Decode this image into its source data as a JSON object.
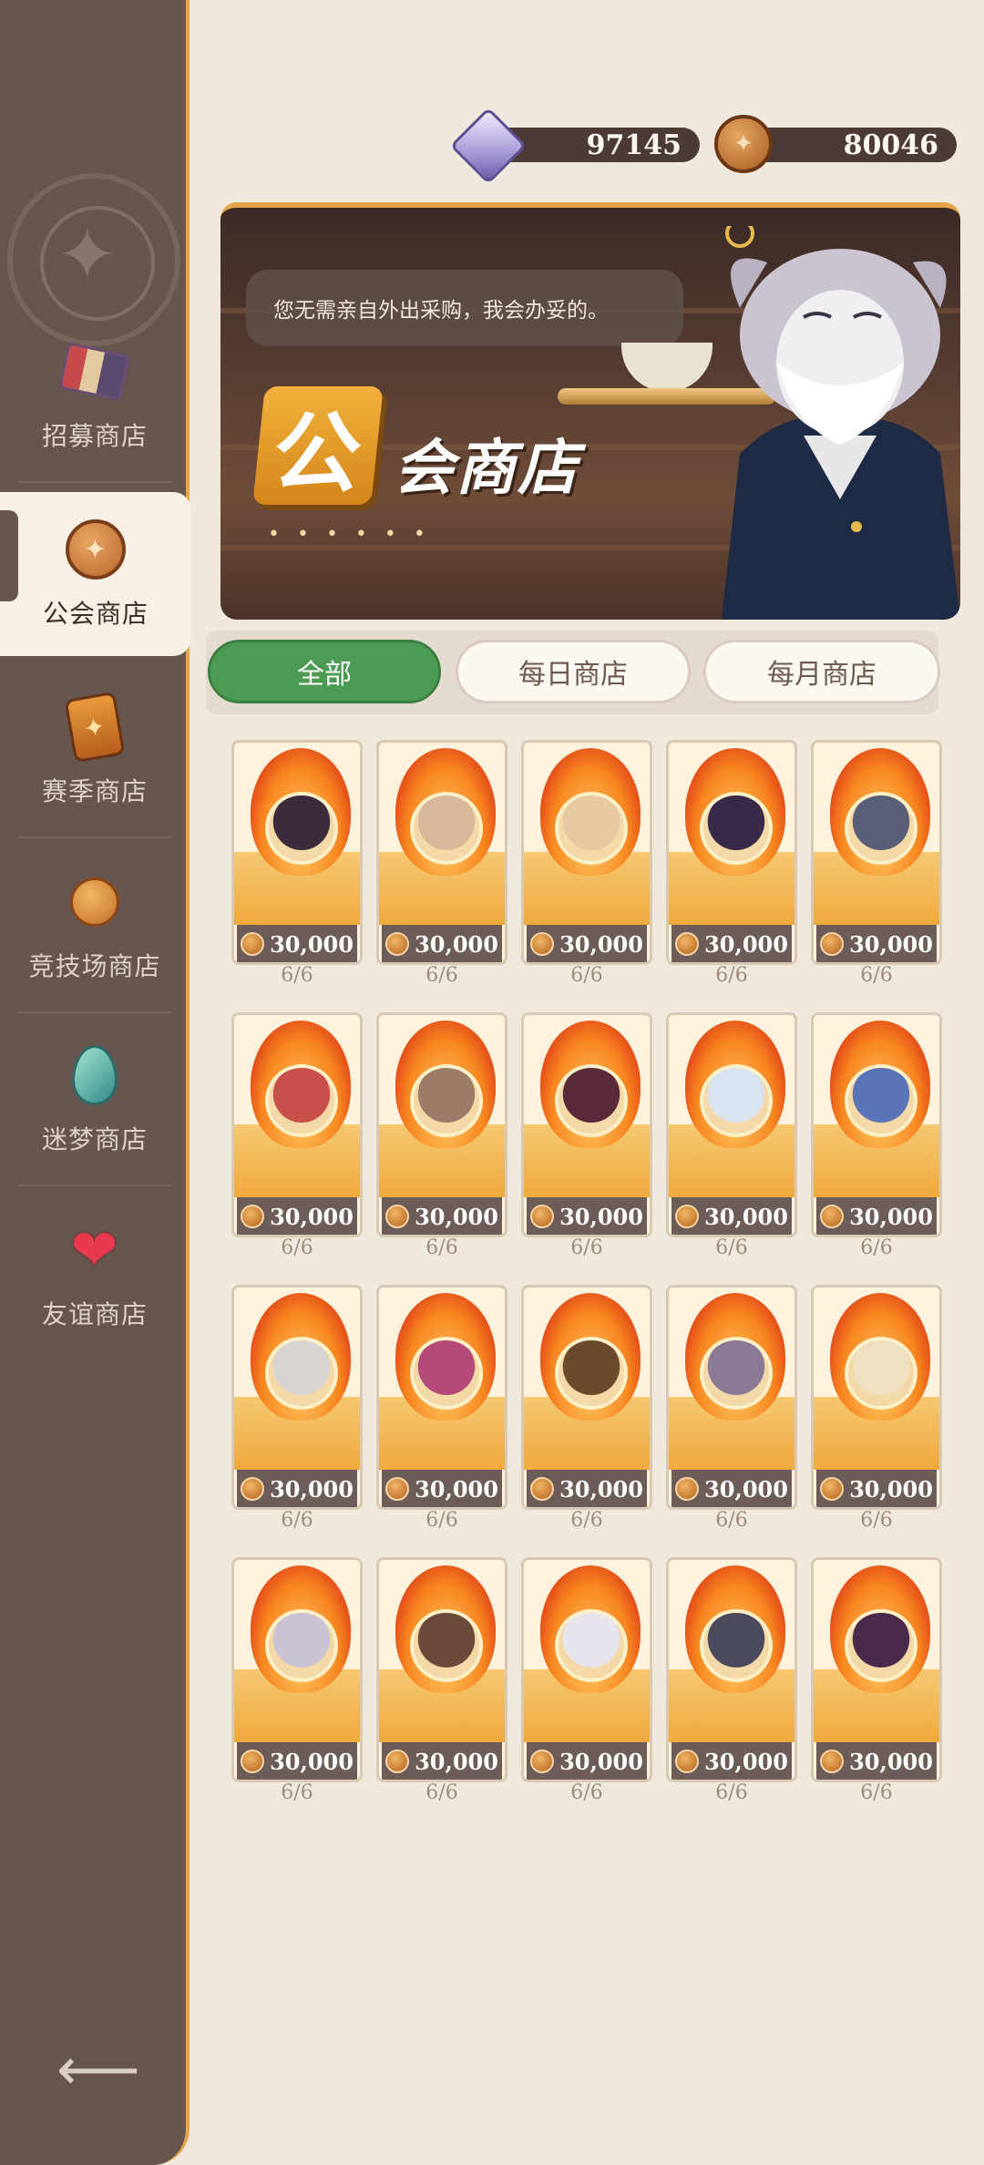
{
  "sidebar": {
    "items": [
      {
        "label": "招募商店",
        "icon": "recruit-ticket-icon"
      },
      {
        "label": "公会商店",
        "icon": "guild-emblem-icon"
      },
      {
        "label": "赛季商店",
        "icon": "season-card-icon"
      },
      {
        "label": "竞技场商店",
        "icon": "arena-coin-icon"
      },
      {
        "label": "迷梦商店",
        "icon": "dream-drop-icon"
      },
      {
        "label": "友谊商店",
        "icon": "heart-icon"
      }
    ],
    "active_index": 1,
    "back_icon": "back-arrow-icon"
  },
  "currency": {
    "diamonds": "97145",
    "guild_coins": "80046"
  },
  "banner": {
    "speech": "您无需亲自外出采购，我会办妥的。",
    "title_first": "公",
    "title_rest": "会商店",
    "dots": "• • • • • •"
  },
  "tabs": [
    {
      "label": "全部",
      "active": true
    },
    {
      "label": "每日商店",
      "active": false
    },
    {
      "label": "每月商店",
      "active": false
    }
  ],
  "items": [
    {
      "price": "30,000",
      "stock": "6/6",
      "color": "#3a2c3a"
    },
    {
      "price": "30,000",
      "stock": "6/6",
      "color": "#d8b89a"
    },
    {
      "price": "30,000",
      "stock": "6/6",
      "color": "#e6c9a3"
    },
    {
      "price": "30,000",
      "stock": "6/6",
      "color": "#3a2a4a"
    },
    {
      "price": "30,000",
      "stock": "6/6",
      "color": "#5a5f78"
    },
    {
      "price": "30,000",
      "stock": "6/6",
      "color": "#c8504a"
    },
    {
      "price": "30,000",
      "stock": "6/6",
      "color": "#9a7c68"
    },
    {
      "price": "30,000",
      "stock": "6/6",
      "color": "#5a2a3a"
    },
    {
      "price": "30,000",
      "stock": "6/6",
      "color": "#d9e3ef"
    },
    {
      "price": "30,000",
      "stock": "6/6",
      "color": "#5b74b8"
    },
    {
      "price": "30,000",
      "stock": "6/6",
      "color": "#d8d4d2"
    },
    {
      "price": "30,000",
      "stock": "6/6",
      "color": "#b34a78"
    },
    {
      "price": "30,000",
      "stock": "6/6",
      "color": "#6a4a2a"
    },
    {
      "price": "30,000",
      "stock": "6/6",
      "color": "#8a7a96"
    },
    {
      "price": "30,000",
      "stock": "6/6",
      "color": "#efe0c4"
    },
    {
      "price": "30,000",
      "stock": "6/6",
      "color": "#c9c3d4"
    },
    {
      "price": "30,000",
      "stock": "6/6",
      "color": "#6a4a3a"
    },
    {
      "price": "30,000",
      "stock": "6/6",
      "color": "#e8e4ee"
    },
    {
      "price": "30,000",
      "stock": "6/6",
      "color": "#4a4a5e"
    },
    {
      "price": "30,000",
      "stock": "6/6",
      "color": "#4a2a4a"
    }
  ]
}
